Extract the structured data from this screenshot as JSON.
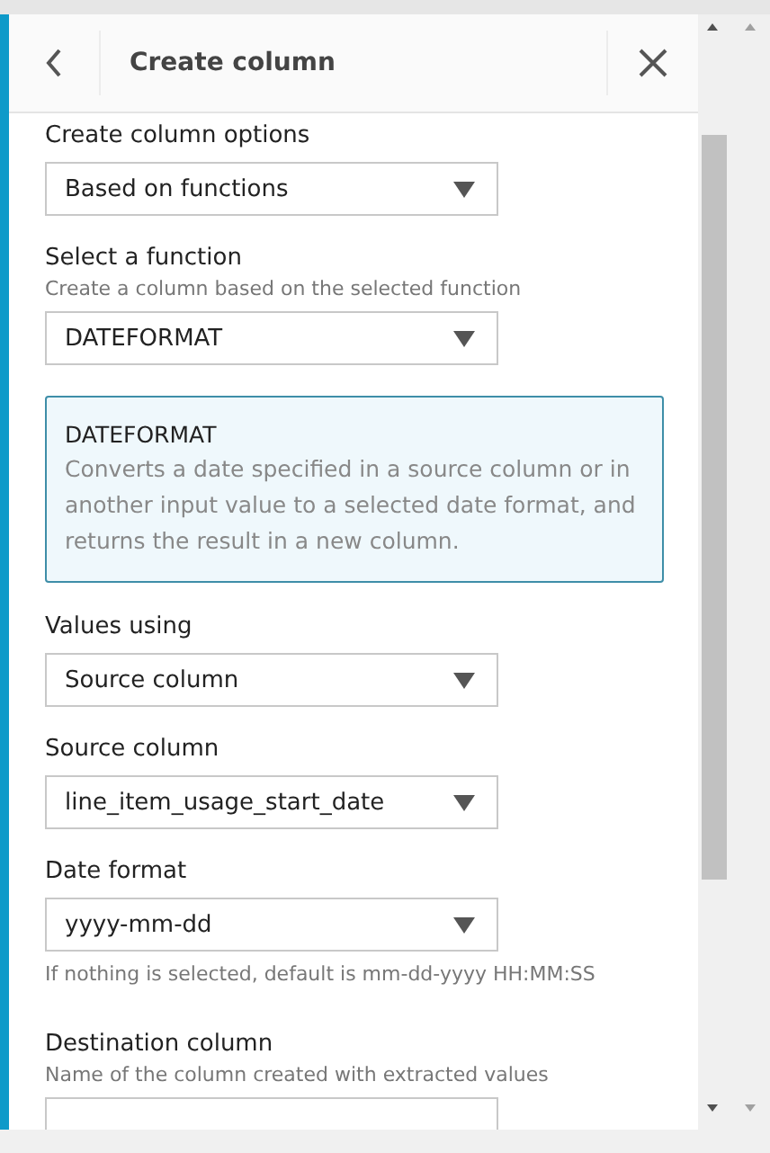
{
  "panel": {
    "title": "Create column"
  },
  "fields": [
    {
      "kind": "select",
      "label": "Create column options",
      "value": "Based on functions"
    },
    {
      "kind": "select",
      "label": "Select a function",
      "description": "Create a column based on the selected function",
      "value": "DATEFORMAT"
    },
    {
      "kind": "info",
      "title": "DATEFORMAT",
      "text": "Converts a date specified in a source column or in another input value to a selected date format, and returns the result in a new column."
    },
    {
      "kind": "select",
      "label": "Values using",
      "value": "Source column"
    },
    {
      "kind": "select",
      "label": "Source column",
      "value": "line_item_usage_start_date"
    },
    {
      "kind": "select",
      "label": "Date format",
      "value": "yyyy-mm-dd",
      "hint": "If nothing is selected, default is mm-dd-yyyy HH:MM:SS"
    },
    {
      "kind": "input",
      "label": "Destination column",
      "description": "Name of the column created with extracted values"
    }
  ]
}
